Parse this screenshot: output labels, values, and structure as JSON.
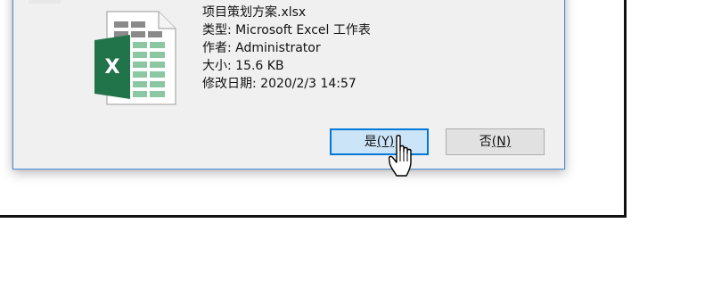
{
  "file": {
    "name": "项目策划方案.xlsx",
    "type_line": "类型: Microsoft Excel 工作表",
    "author_line": "作者: Administrator",
    "size_line": "大小: 15.6 KB",
    "modified_line": "修改日期: 2020/2/3 14:57",
    "icon": "excel-file-icon",
    "icon_letter": "X"
  },
  "buttons": {
    "yes_label": "是",
    "yes_accel": "(Y)",
    "no_label": "否",
    "no_accel": "(N)"
  },
  "colors": {
    "excel_green": "#21734a",
    "excel_cell_green": "#8cc7a3",
    "dialog_bg": "#f0f0f0",
    "focus_blue": "#0078d7",
    "focus_fill": "#cce4f7"
  }
}
